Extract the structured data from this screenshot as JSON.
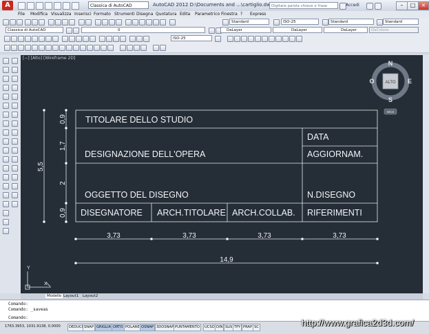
{
  "title_bar": {
    "workspace": "Classica di AutoCAD",
    "app_title": "AutoCAD 2012   D:\\Documents and ...\\cartiglio.dwg",
    "search_placeholder": "Digitare parola chiave o frase",
    "login_label": "Accedi"
  },
  "menu": [
    "File",
    "Modifica",
    "Visualizza",
    "Inserisci",
    "Formato",
    "Strumenti",
    "Disegna",
    "Quotatura",
    "Edita",
    "Parametrico",
    "Finestra",
    "?",
    "Express"
  ],
  "toolbar1": {
    "text_style": "Standard",
    "dim_style": "ISO-25",
    "table_style": "Standard",
    "mleader_style": "Standard"
  },
  "toolbar2": {
    "workspace": "Classica di AutoCAD",
    "layer": "0",
    "color": "DaLayer",
    "linetype": "DaLayer",
    "lineweight": "DaLayer",
    "plotstyle": "DaColore"
  },
  "toolbar3": {
    "dim_style": "ISO-25"
  },
  "viewport_label": "[−] [Alto] [Wireframe 2D]",
  "viewcube": {
    "face": "ALTO",
    "n": "N",
    "s": "S",
    "e": "E",
    "w": "O",
    "wcs": "WCS"
  },
  "drawing": {
    "cells": {
      "titolare": "TITOLARE DELLO STUDIO",
      "data": "DATA",
      "designazione": "DESIGNAZIONE DELL'OPERA",
      "aggiornam": "AGGIORNAM.",
      "oggetto": "OGGETTO DEL DISEGNO",
      "n_disegno": "N.DISEGNO",
      "disegnatore": "DISEGNATORE",
      "arch_titolare": "ARCH.TITOLARE",
      "arch_collab": "ARCH.COLLAB.",
      "riferimenti": "RIFERIMENTI"
    },
    "vertical_dims": [
      "0,9",
      "1,7",
      "2",
      "0,9"
    ],
    "total_height_dim": "5,5",
    "horizontal_dims": [
      "3,73",
      "3,73",
      "3,73",
      "3,73"
    ],
    "total_width_dim": "14,9",
    "ucs": {
      "x": "X",
      "y": "Y"
    }
  },
  "tabs": [
    "Modello",
    "Layout1",
    "Layout2"
  ],
  "command_lines": [
    "Comando:",
    "Comando: _saveas",
    "Comando:"
  ],
  "status": {
    "coords": "1763.3953, 1031.9138, 0.0000",
    "buttons": [
      "DEDUCI",
      "SNAP",
      "GRIGLIA",
      "ORTO",
      "POLARE",
      "OSNAP",
      "3DOSNAP",
      "PUNTAMENTO",
      "UCSD",
      "DIN",
      "SLN",
      "TPY",
      "PRAP",
      "SC"
    ],
    "active": [
      "GRIGLIA",
      "ORTO",
      "OSNAP"
    ]
  },
  "watermark": "http://www.grafica2d3d.com/"
}
